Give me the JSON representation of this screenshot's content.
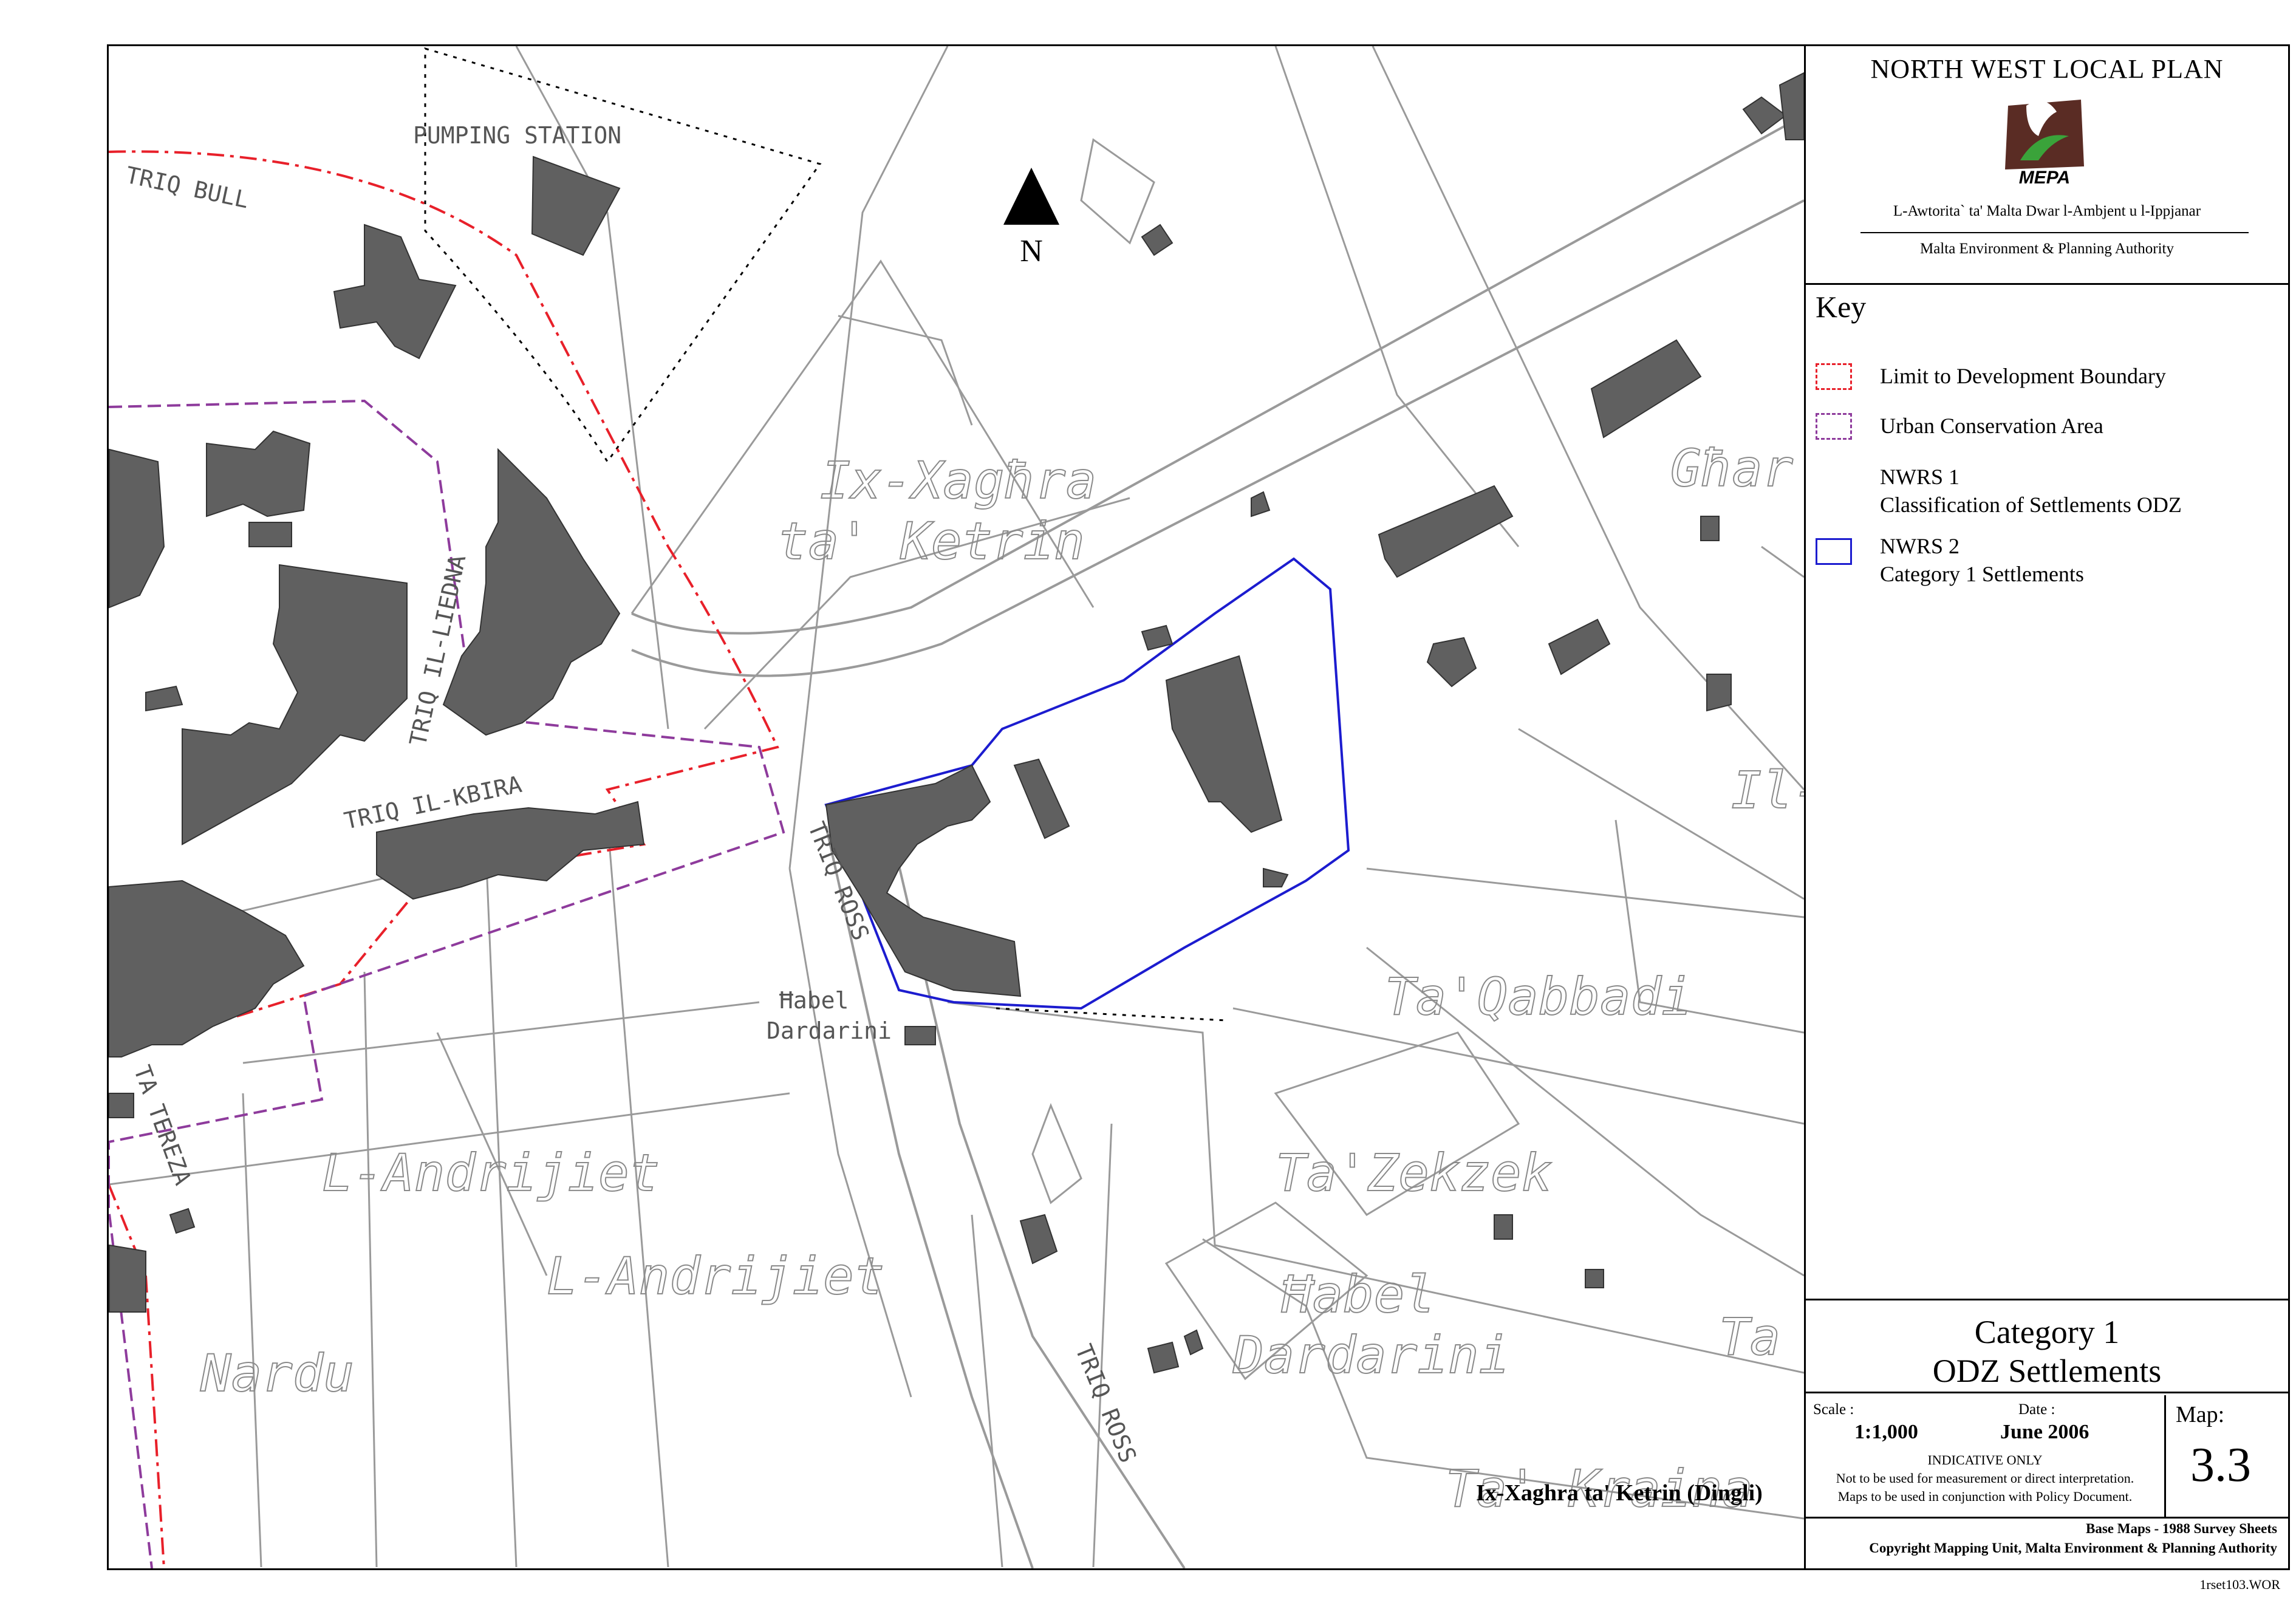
{
  "header": {
    "title": "NORTH WEST LOCAL PLAN",
    "logo_text": "MEPA",
    "authority_maltese": "L-Awtorita` ta' Malta Dwar l-Ambjent u l-Ippjanar",
    "authority_english": "Malta Environment & Planning Authority"
  },
  "key": {
    "title": "Key",
    "items": [
      {
        "swatch": "red-dash",
        "label": "Limit to Development Boundary",
        "color": "#e8202a"
      },
      {
        "swatch": "purple-dash",
        "label": "Urban Conservation Area",
        "color": "#8e3b9c"
      },
      {
        "swatch": "none",
        "label": "NWRS 1",
        "label2": "Classification of Settlements ODZ"
      },
      {
        "swatch": "blue-box",
        "label": "NWRS 2",
        "label2": "Category 1 Settlements",
        "color": "#1c1ccf"
      }
    ]
  },
  "category": {
    "line1": "Category 1",
    "line2": "ODZ Settlements"
  },
  "info": {
    "scale_label": "Scale :",
    "scale_value": "1:1,000",
    "date_label": "Date :",
    "date_value": "June 2006",
    "indicative": "INDICATIVE ONLY",
    "note1": "Not to be used for measurement or direct interpretation.",
    "note2": "Maps to be used in conjunction with Policy Document.",
    "map_label": "Map:",
    "map_number": "3.3"
  },
  "credits": {
    "line1": "Base Maps - 1988 Survey Sheets",
    "line2": "Copyright Mapping Unit, Malta Environment & Planning Authority"
  },
  "file_code": "1rset103.WOR",
  "map": {
    "north_label": "N",
    "settlement_caption": "Ix-Xaghra ta' Ketrin (Dingli)",
    "place_names": [
      "Ix-Xagħra",
      "ta' Ketrin",
      "Għar",
      "Il-",
      "Ta'Qabbadi",
      "Ta'Zekzek",
      "Ħabel",
      "Dardarini",
      "L-Andrijiet",
      "L-Andrijiet",
      "Nardu",
      "Ta",
      "Ta' Kraina"
    ],
    "small_labels": [
      "Ħabel",
      "Dardarini"
    ],
    "street_names": [
      "PUMPING STATION",
      "TRIQ BULL",
      "TRIQ IL-KBIRA",
      "TRIQ IL-LIEDNA",
      "TRIQ ROSS",
      "TRIQ ROSS",
      "TA TEREZA"
    ],
    "colors": {
      "building": "#606060",
      "line": "#9a9a9a",
      "boundary": "#e8202a",
      "conservation": "#8e3b9c",
      "settlement": "#1c1ccf"
    }
  }
}
